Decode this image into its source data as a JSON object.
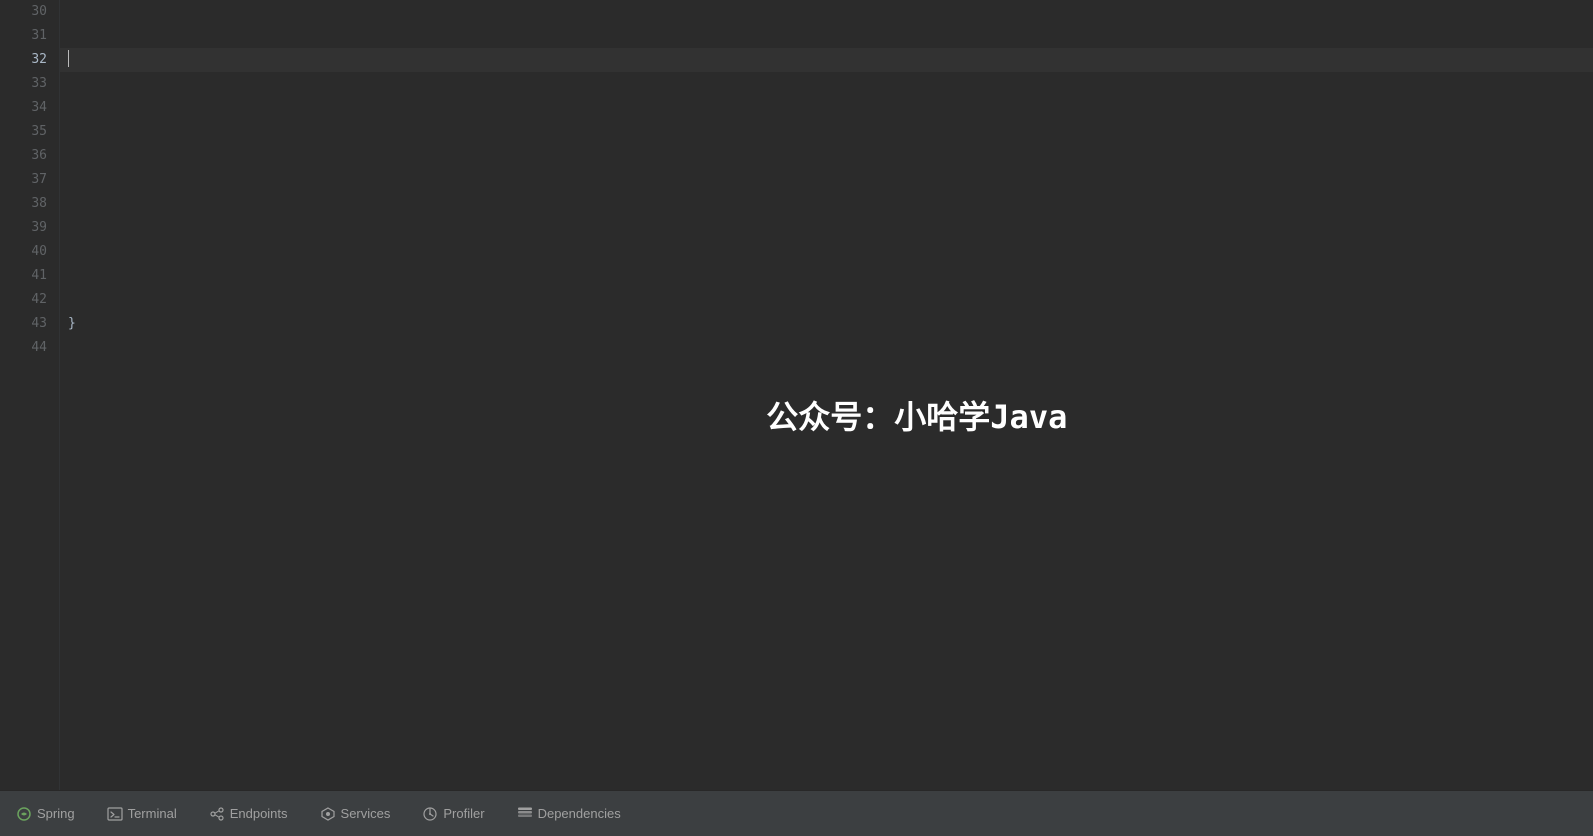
{
  "editor": {
    "background_color": "#2b2b2b",
    "current_line": 32,
    "lines": [
      {
        "number": 30,
        "content": ""
      },
      {
        "number": 31,
        "content": ""
      },
      {
        "number": 32,
        "content": "",
        "active": true,
        "has_cursor": true
      },
      {
        "number": 33,
        "content": ""
      },
      {
        "number": 34,
        "content": ""
      },
      {
        "number": 35,
        "content": ""
      },
      {
        "number": 36,
        "content": ""
      },
      {
        "number": 37,
        "content": ""
      },
      {
        "number": 38,
        "content": ""
      },
      {
        "number": 39,
        "content": ""
      },
      {
        "number": 40,
        "content": ""
      },
      {
        "number": 41,
        "content": ""
      },
      {
        "number": 42,
        "content": ""
      },
      {
        "number": 43,
        "content": "}",
        "has_brace": true
      },
      {
        "number": 44,
        "content": ""
      }
    ],
    "watermark": "公众号：小哈学Java"
  },
  "bottom_bar": {
    "tabs": [
      {
        "id": "spring",
        "label": "Spring",
        "icon": "spring-icon"
      },
      {
        "id": "terminal",
        "label": "Terminal",
        "icon": "terminal-icon"
      },
      {
        "id": "endpoints",
        "label": "Endpoints",
        "icon": "endpoints-icon"
      },
      {
        "id": "services",
        "label": "Services",
        "icon": "services-icon"
      },
      {
        "id": "profiler",
        "label": "Profiler",
        "icon": "profiler-icon"
      },
      {
        "id": "dependencies",
        "label": "Dependencies",
        "icon": "dependencies-icon"
      }
    ]
  }
}
